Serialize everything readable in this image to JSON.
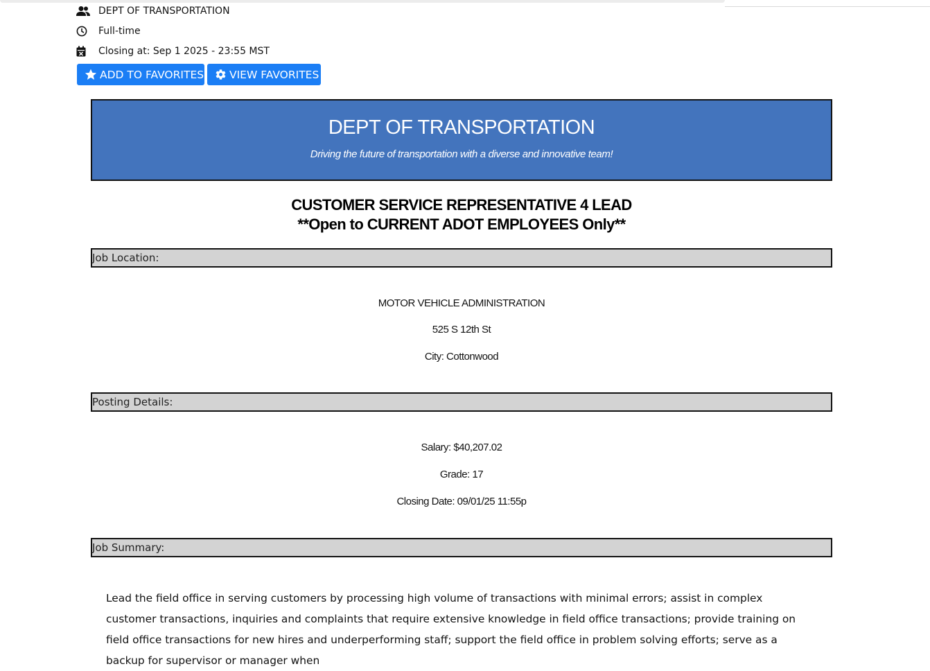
{
  "meta": {
    "department": "DEPT OF TRANSPORTATION",
    "schedule": "Full-time",
    "closing": "Closing at: Sep 1 2025 - 23:55 MST"
  },
  "actions": {
    "add_favorites": "ADD TO FAVORITES",
    "view_favorites": "VIEW FAVORITES"
  },
  "banner": {
    "title": "DEPT OF TRANSPORTATION",
    "tagline": "Driving the future of transportation with a diverse and innovative team!",
    "color": "#4374bd"
  },
  "job": {
    "title_line1": "CUSTOMER SERVICE REPRESENTATIVE 4 LEAD",
    "title_line2": "**Open to CURRENT ADOT EMPLOYEES Only**"
  },
  "location": {
    "header": "Job Location:",
    "agency": "MOTOR VEHICLE ADMINISTRATION",
    "address": "525 S 12th St",
    "city": "City: Cottonwood"
  },
  "posting": {
    "header": "Posting Details:",
    "salary": "Salary: $40,207.02",
    "grade": "Grade: 17",
    "closing_date": "Closing Date: 09/01/25 11:55p"
  },
  "summary": {
    "header": "Job Summary:",
    "text": "Lead the field office in serving customers by processing high volume of transactions with minimal errors; assist in complex customer transactions, inquiries and complaints that require extensive knowledge in field office transactions; provide training on field office transactions for new hires and underperforming staff; support the field office in problem solving efforts; serve as a backup for supervisor or manager when"
  },
  "icons": {
    "department": "people-icon",
    "schedule": "clock-icon",
    "closing": "calendar-icon",
    "favorite": "star-icon",
    "settings": "gear-icon"
  },
  "colors": {
    "button": "#1b7ef5",
    "section_bar": "#d3d3d3"
  }
}
